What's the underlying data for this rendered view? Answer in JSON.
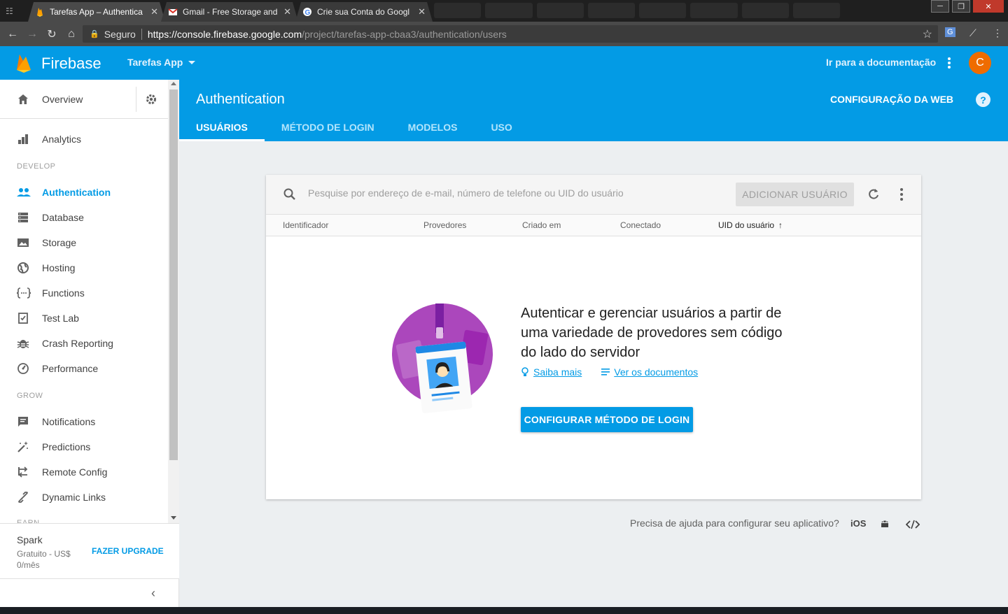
{
  "browser": {
    "tabs": [
      {
        "title": "Tarefas App – Authentica",
        "active": true
      },
      {
        "title": "Gmail - Free Storage and",
        "active": false
      },
      {
        "title": "Crie sua Conta do Googl",
        "active": false
      }
    ],
    "secure_label": "Seguro",
    "url_host": "https://console.firebase.google.com",
    "url_path": "/project/tarefas-app-cbaa3/authentication/users"
  },
  "header": {
    "brand": "Firebase",
    "project": "Tarefas App",
    "docs_link": "Ir para a documentação",
    "avatar_letter": "C"
  },
  "sidebar": {
    "overview": "Overview",
    "analytics": "Analytics",
    "sections": {
      "develop": "DEVELOP",
      "grow": "GROW",
      "earn": "EARN"
    },
    "develop_items": [
      {
        "label": "Authentication",
        "icon": "people-icon"
      },
      {
        "label": "Database",
        "icon": "database-icon"
      },
      {
        "label": "Storage",
        "icon": "image-icon"
      },
      {
        "label": "Hosting",
        "icon": "globe-icon"
      },
      {
        "label": "Functions",
        "icon": "functions-icon"
      },
      {
        "label": "Test Lab",
        "icon": "checklist-icon"
      },
      {
        "label": "Crash Reporting",
        "icon": "bug-icon"
      },
      {
        "label": "Performance",
        "icon": "speedometer-icon"
      }
    ],
    "grow_items": [
      {
        "label": "Notifications",
        "icon": "message-icon"
      },
      {
        "label": "Predictions",
        "icon": "wand-icon"
      },
      {
        "label": "Remote Config",
        "icon": "remote-config-icon"
      },
      {
        "label": "Dynamic Links",
        "icon": "link-icon"
      }
    ],
    "plan": {
      "name": "Spark",
      "price": "Gratuito - US$ 0/mês",
      "upgrade": "FAZER UPGRADE"
    }
  },
  "main": {
    "title": "Authentication",
    "web_config": "CONFIGURAÇÃO DA WEB",
    "tabs": [
      "USUÁRIOS",
      "MÉTODO DE LOGIN",
      "MODELOS",
      "USO"
    ],
    "search_placeholder": "Pesquise por endereço de e-mail, número de telefone ou UID do usuário",
    "add_user": "ADICIONAR USUÁRIO",
    "columns": [
      "Identificador",
      "Provedores",
      "Criado em",
      "Conectado",
      "UID do usuário"
    ],
    "empty_state": {
      "message": "Autenticar e gerenciar usuários a partir de uma variedade de provedores sem código do lado do servidor",
      "learn_more": "Saiba mais",
      "view_docs": "Ver os documentos",
      "cta": "CONFIGURAR MÉTODO DE LOGIN"
    },
    "help_text": "Precisa de ajuda para configurar seu aplicativo?",
    "platforms": [
      "iOS"
    ]
  },
  "colors": {
    "primary": "#039be5",
    "header": "#039be5",
    "avatar": "#ef6c00",
    "background": "#eceff1"
  }
}
